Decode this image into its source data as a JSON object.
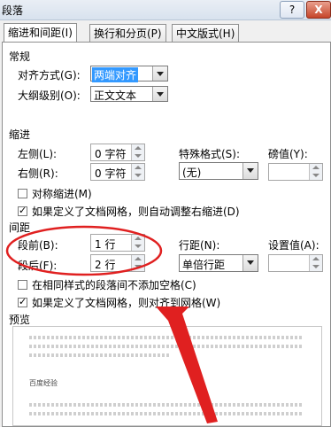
{
  "dialog": {
    "title": "段落",
    "help_button": "?",
    "close_button": "X"
  },
  "tabs": [
    {
      "label": "缩进和间距(I)"
    },
    {
      "label": "换行和分页(P)"
    },
    {
      "label": "中文版式(H)"
    }
  ],
  "general": {
    "section_label": "常规",
    "alignment_label": "对齐方式(G):",
    "alignment_value": "两端对齐",
    "outline_label": "大纲级别(O):",
    "outline_value": "正文文本"
  },
  "indent": {
    "section_label": "缩进",
    "left_label": "左侧(L):",
    "left_value": "0 字符",
    "right_label": "右侧(R):",
    "right_value": "0 字符",
    "special_label": "特殊格式(S):",
    "special_value": "(无)",
    "by_label": "磅值(Y):",
    "mirror_label": "对称缩进(M)",
    "auto_adjust_label": "如果定义了文档网格，则自动调整右缩进(D)"
  },
  "spacing": {
    "section_label": "间距",
    "before_label": "段前(B):",
    "before_value": "1 行",
    "after_label": "段后(F):",
    "after_value": "2 行",
    "line_label": "行距(N):",
    "line_value": "单倍行距",
    "at_label": "设置值(A):",
    "no_space_label": "在相同样式的段落间不添加空格(C)",
    "snap_grid_label": "如果定义了文档网格，则对齐到网格(W)"
  },
  "preview": {
    "section_label": "预览",
    "sample_text": "百度经验"
  },
  "colors": {
    "annotation": "#e02020",
    "selection": "#3399ff"
  }
}
